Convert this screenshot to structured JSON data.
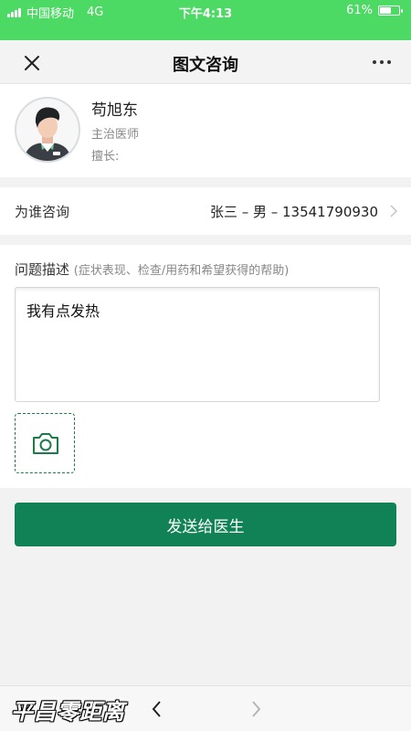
{
  "status_bar": {
    "carrier": "中国移动",
    "network": "4G",
    "time": "下午4:13",
    "battery": "61%",
    "battery_level": 0.61
  },
  "nav": {
    "title": "图文咨询",
    "close_icon": "close-icon",
    "more_icon": "more-icon"
  },
  "doctor": {
    "name": "苟旭东",
    "title": "主治医师",
    "specialty": "擅长:"
  },
  "consult_for": {
    "label": "为谁咨询",
    "patient": "张三 – 男 – 13541790930"
  },
  "question": {
    "label": "问题描述",
    "hint": "(症状表现、检查/用药和希望获得的帮助)",
    "text": "我有点发热",
    "camera_icon": "camera-icon"
  },
  "send_button": "发送给医生",
  "footer": {
    "watermark": "平昌零距离"
  },
  "colors": {
    "status_green": "#4cd964",
    "primary_green": "#108255"
  }
}
